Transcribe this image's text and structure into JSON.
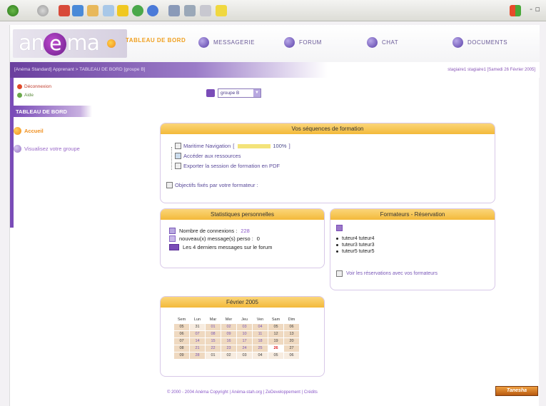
{
  "browser": {
    "window_controls": "- ▫"
  },
  "header": {
    "logo": {
      "left": "an",
      "e": "e",
      "right": "ma"
    },
    "nav": [
      {
        "label": "TABLEAU DE BORD",
        "active": true
      },
      {
        "label": "MESSAGERIE"
      },
      {
        "label": "FORUM"
      },
      {
        "label": "CHAT"
      },
      {
        "label": "DOCUMENTS"
      }
    ]
  },
  "breadcrumb": "[Anéma Standard] Apprenant > TABLEAU DE BORD [groupe B]",
  "user_info": "stagiaire1 stagiaire1 [Samedi 26 Février 2005]",
  "sidebar": {
    "deconnexion": "Déconnexion",
    "aide": "Aide",
    "title": "TABLEAU DE BORD",
    "menu": [
      "Accueil",
      "Visualisez votre groupe"
    ]
  },
  "group_select": {
    "value": "groupe B"
  },
  "sequences": {
    "title": "Vos séquences de formation",
    "module": "Maritime Navigation",
    "progress_pct": "100%",
    "progress_value": 1.0,
    "resources": "Accéder aux ressources",
    "export": "Exporter la session de formation en PDF",
    "objectives": "Objectifs fixés par votre formateur :"
  },
  "stats": {
    "title": "Statistiques personnelles",
    "connexions_label": "Nombre de connexions :",
    "connexions_value": "228",
    "messages_label": "nouveau(x) message(s) perso :",
    "messages_value": "0",
    "forum_label": "Les 4 derniers messages sur le forum"
  },
  "formateurs": {
    "title": "Formateurs - Réservation",
    "tutors": [
      "tuteur4 tuteur4",
      "tuteur3 tuteur3",
      "tuteur5 tuteur5"
    ],
    "reservations_link": "Voir les réservations avec vos formateurs"
  },
  "calendar": {
    "title": "Février 2005",
    "days": [
      "Sem",
      "Lun",
      "Mar",
      "Mer",
      "Jeu",
      "Ven",
      "Sam",
      "Dim"
    ],
    "weeks": [
      [
        "05",
        "31",
        "01",
        "02",
        "03",
        "04",
        "05",
        "06"
      ],
      [
        "06",
        "07",
        "08",
        "09",
        "10",
        "11",
        "12",
        "13"
      ],
      [
        "07",
        "14",
        "15",
        "16",
        "17",
        "18",
        "19",
        "20"
      ],
      [
        "08",
        "21",
        "22",
        "23",
        "24",
        "25",
        "26",
        "27"
      ],
      [
        "09",
        "28",
        "01",
        "02",
        "03",
        "04",
        "05",
        "06"
      ]
    ],
    "today": "26"
  },
  "footer": "© 2000 - 2004 Anéma Copyright | Anéma-stah.org | ZeDeveloppement | Crédits",
  "badge": "Tanesha"
}
